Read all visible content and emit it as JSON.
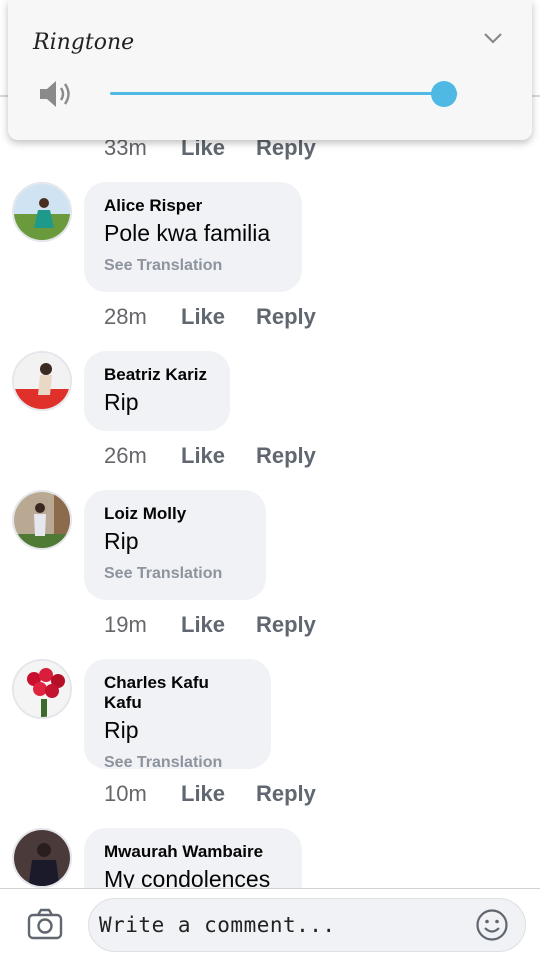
{
  "volume_panel": {
    "title": "Ringtone",
    "level": 0.96,
    "accent_color": "#4fb9e3",
    "icons": [
      "speaker-icon",
      "chevron-down-icon"
    ]
  },
  "partial_meta": {
    "time": "33m",
    "like": "Like",
    "reply": "Reply"
  },
  "comments": [
    {
      "author": "Alice Risper",
      "text": "Pole kwa familia",
      "translation": "See Translation",
      "time": "28m",
      "like": "Like",
      "reply": "Reply"
    },
    {
      "author": "Beatriz Kariz",
      "text": "Rip",
      "translation": "",
      "time": "26m",
      "like": "Like",
      "reply": "Reply"
    },
    {
      "author": "Loiz Molly",
      "text": "Rip",
      "translation": "See Translation",
      "time": "19m",
      "like": "Like",
      "reply": "Reply"
    },
    {
      "author": "Charles Kafu Kafu",
      "text": "Rip",
      "translation": "See Translation",
      "time": "10m",
      "like": "Like",
      "reply": "Reply"
    },
    {
      "author": "Mwaurah Wambaire",
      "text": "My condolences",
      "translation": "",
      "time": "",
      "like": "",
      "reply": ""
    }
  ],
  "composer": {
    "placeholder": "Write a comment...",
    "icons": [
      "camera-icon",
      "emoji-icon"
    ]
  }
}
